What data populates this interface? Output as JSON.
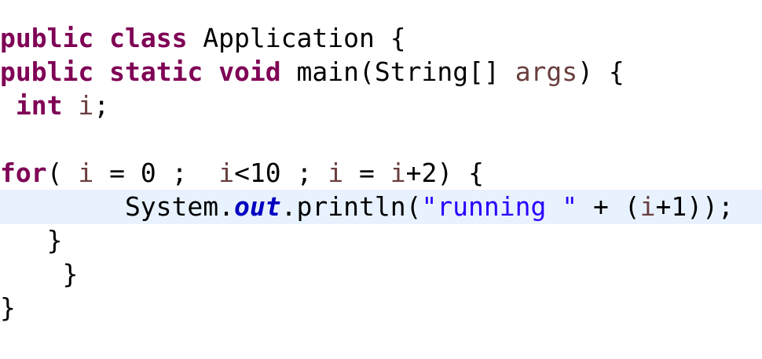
{
  "editor": {
    "lines": [
      {
        "tokens": [
          {
            "type": "kw",
            "text": "public"
          },
          {
            "type": "plain",
            "text": " "
          },
          {
            "type": "kw",
            "text": "class"
          },
          {
            "type": "plain",
            "text": " Application {"
          }
        ]
      },
      {
        "tokens": [
          {
            "type": "kw",
            "text": "public"
          },
          {
            "type": "plain",
            "text": " "
          },
          {
            "type": "kw",
            "text": "static"
          },
          {
            "type": "plain",
            "text": " "
          },
          {
            "type": "kw",
            "text": "void"
          },
          {
            "type": "plain",
            "text": " main(String[] "
          },
          {
            "type": "local",
            "text": "args"
          },
          {
            "type": "plain",
            "text": ") {"
          }
        ]
      },
      {
        "tokens": [
          {
            "type": "plain",
            "text": " "
          },
          {
            "type": "kw",
            "text": "int"
          },
          {
            "type": "plain",
            "text": " "
          },
          {
            "type": "local",
            "text": "i"
          },
          {
            "type": "plain",
            "text": ";"
          }
        ]
      },
      {
        "tokens": []
      },
      {
        "tokens": [
          {
            "type": "kw",
            "text": "for"
          },
          {
            "type": "plain",
            "text": "( "
          },
          {
            "type": "local",
            "text": "i"
          },
          {
            "type": "plain",
            "text": " = 0 ;  "
          },
          {
            "type": "local",
            "text": "i"
          },
          {
            "type": "plain",
            "text": "<10 ; "
          },
          {
            "type": "local",
            "text": "i"
          },
          {
            "type": "plain",
            "text": " = "
          },
          {
            "type": "local",
            "text": "i"
          },
          {
            "type": "plain",
            "text": "+2) {"
          }
        ]
      },
      {
        "current": true,
        "tokens": [
          {
            "type": "plain",
            "text": "        System."
          },
          {
            "type": "field",
            "text": "out"
          },
          {
            "type": "plain",
            "text": ".println("
          },
          {
            "type": "str",
            "text": "\"running \""
          },
          {
            "type": "plain",
            "text": " + ("
          },
          {
            "type": "local",
            "text": "i"
          },
          {
            "type": "plain",
            "text": "+1));"
          }
        ]
      },
      {
        "tokens": [
          {
            "type": "plain",
            "text": "   }"
          }
        ]
      },
      {
        "tokens": [
          {
            "type": "plain",
            "text": "    }"
          }
        ]
      },
      {
        "tokens": [
          {
            "type": "plain",
            "text": "}"
          }
        ]
      }
    ]
  }
}
